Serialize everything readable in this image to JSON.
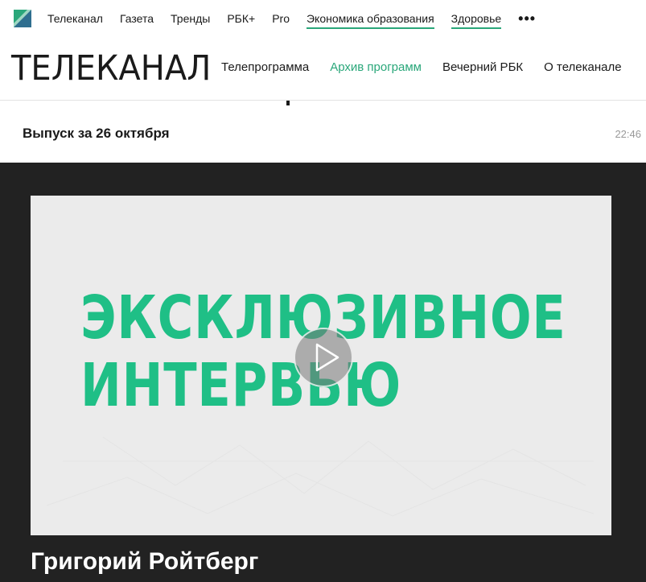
{
  "top_nav": {
    "items": [
      {
        "label": "Телеканал",
        "underlined": false
      },
      {
        "label": "Газета",
        "underlined": false
      },
      {
        "label": "Тренды",
        "underlined": false
      },
      {
        "label": "РБК+",
        "underlined": false
      },
      {
        "label": "Pro",
        "underlined": false
      },
      {
        "label": "Экономика образования",
        "underlined": true
      },
      {
        "label": "Здоровье",
        "underlined": true
      }
    ],
    "more_label": "•••"
  },
  "section": {
    "title": "ТЕЛЕКАНАЛ",
    "menu": [
      {
        "label": "Телепрограмма",
        "active": false
      },
      {
        "label": "Архив программ",
        "active": true
      },
      {
        "label": "Вечерний РБК",
        "active": false
      },
      {
        "label": "О телеканале",
        "active": false
      }
    ]
  },
  "episode": {
    "title": "Выпуск за 26 октября",
    "time": "22:46"
  },
  "video": {
    "headline_line1": "ЭКСКЛЮЗИВНОЕ",
    "headline_line2": "ИНТЕРВЬЮ",
    "play_icon": "play-icon"
  },
  "guest": {
    "name": "Григорий Ройтберг"
  },
  "colors": {
    "accent": "#2aa77a",
    "headline": "#1fbf86",
    "dark_bg": "#222222",
    "video_bg": "#ebebeb"
  }
}
